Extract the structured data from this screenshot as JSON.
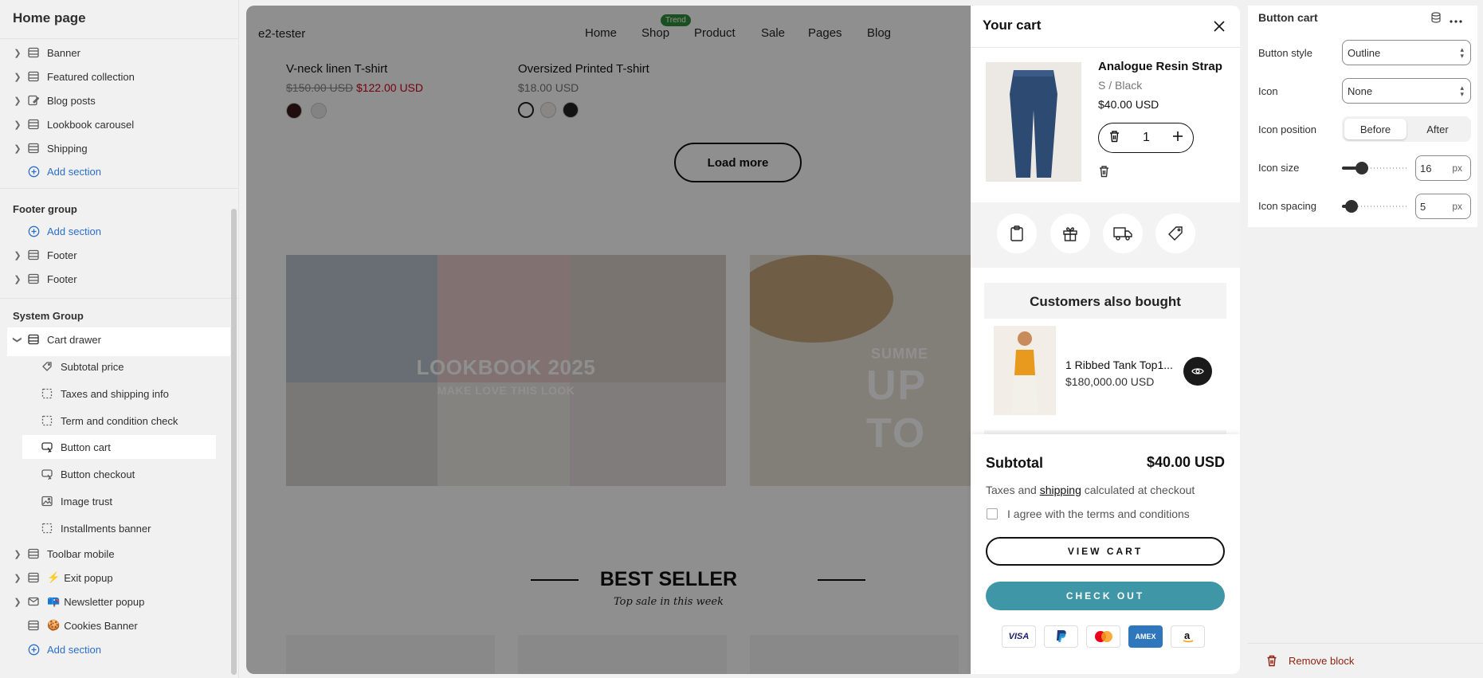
{
  "sidebar": {
    "title": "Home page",
    "sections": [
      {
        "label": "Banner",
        "icon": "layout-section-icon"
      },
      {
        "label": "Featured collection",
        "icon": "layout-section-icon"
      },
      {
        "label": "Blog posts",
        "icon": "blog-edit-icon"
      },
      {
        "label": "Lookbook carousel",
        "icon": "layout-section-icon"
      },
      {
        "label": "Shipping",
        "icon": "layout-section-icon"
      }
    ],
    "add_section": "Add section",
    "footer_group": {
      "title": "Footer group",
      "items": [
        {
          "label": "Footer",
          "icon": "layout-section-icon"
        },
        {
          "label": "Footer",
          "icon": "layout-section-icon"
        }
      ]
    },
    "system_group": {
      "title": "System Group",
      "cart_drawer": "Cart drawer",
      "cart_children": [
        {
          "label": "Subtotal price",
          "icon": "block-icon"
        },
        {
          "label": "Taxes and shipping info",
          "icon": "dashed-block-icon"
        },
        {
          "label": "Term and condition check",
          "icon": "dashed-block-icon"
        },
        {
          "label": "Button cart",
          "icon": "button-icon"
        },
        {
          "label": "Button checkout",
          "icon": "button-icon"
        },
        {
          "label": "Image trust",
          "icon": "image-icon"
        },
        {
          "label": "Installments banner",
          "icon": "dashed-block-icon"
        }
      ],
      "more": [
        {
          "label": "Toolbar mobile",
          "prefix": ""
        },
        {
          "label": "Exit popup",
          "prefix": "⚡"
        },
        {
          "label": "Newsletter popup",
          "prefix": "📪"
        },
        {
          "label": "Cookies Banner",
          "prefix": "🍪"
        }
      ]
    }
  },
  "store": {
    "brand": "e2-tester",
    "nav": [
      "Home",
      "Shop",
      "Product",
      "Sale",
      "Pages",
      "Blog"
    ],
    "trend_badge": "Trend",
    "products": [
      {
        "name": "V-neck linen T-shirt",
        "old_price": "$150.00 USD",
        "price": "$122.00 USD"
      },
      {
        "name": "Oversized Printed T-shirt",
        "price": "$18.00 USD"
      }
    ],
    "load_more": "Load more",
    "lookbook_title": "LOOKBOOK 2025",
    "lookbook_sub": "MAKE LOVE THIS LOOK",
    "summer_small": "SUMME",
    "summer_big": "UP TO",
    "bestseller_title": "BEST SELLER",
    "bestseller_sub": "Top sale in this week"
  },
  "cart": {
    "title": "Your cart",
    "item": {
      "name": "Analogue Resin Strap",
      "variant": "S / Black",
      "price": "$40.00 USD",
      "qty": "1"
    },
    "also_bought": {
      "title": "Customers also bought",
      "name": "1 Ribbed Tank Top1...",
      "price": "$180,000.00 USD"
    },
    "subtotal_label": "Subtotal",
    "subtotal_value": "$40.00 USD",
    "tax_pre": "Taxes and",
    "tax_link": "shipping",
    "tax_post": "calculated at checkout",
    "agree": "I agree with the terms and conditions",
    "view_cart": "VIEW CART",
    "check_out": "CHECK OUT",
    "payments": [
      "VISA",
      "PayPal",
      "Mastercard",
      "AMEX",
      "Amazon"
    ],
    "colors": {
      "checkout": "#3f96a6",
      "accent": "#2c6ecb"
    }
  },
  "settings": {
    "title": "Button cart",
    "button_style_label": "Button style",
    "button_style_value": "Outline",
    "icon_label": "Icon",
    "icon_value": "None",
    "icon_position_label": "Icon position",
    "icon_position_options": [
      "Before",
      "After"
    ],
    "icon_position_selected": "Before",
    "icon_size_label": "Icon size",
    "icon_size_value": "16",
    "icon_size_fraction": 0.3,
    "icon_spacing_label": "Icon spacing",
    "icon_spacing_value": "5",
    "icon_spacing_fraction": 0.14,
    "unit": "px",
    "remove_block": "Remove block"
  }
}
